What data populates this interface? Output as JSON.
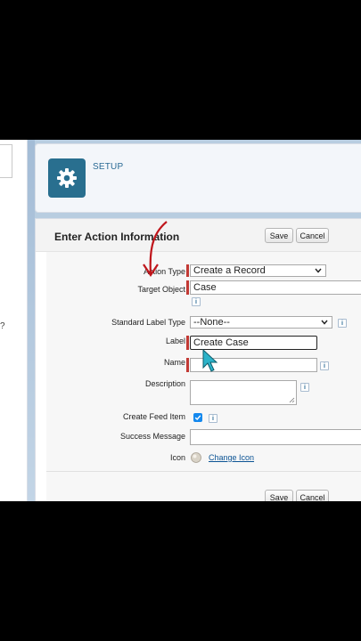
{
  "header": {
    "title": "SETUP",
    "icon": "gear-icon"
  },
  "form": {
    "title": "Enter Action Information",
    "buttons": {
      "save": "Save",
      "cancel": "Cancel"
    },
    "fields": {
      "action_type": {
        "label": "Action Type",
        "value": "Create a Record"
      },
      "target_object": {
        "label": "Target Object",
        "value": "Case"
      },
      "standard_label_type": {
        "label": "Standard Label Type",
        "value": "--None--"
      },
      "label": {
        "label": "Label",
        "value": "Create Case"
      },
      "name": {
        "label": "Name",
        "value": ""
      },
      "description": {
        "label": "Description",
        "value": ""
      },
      "create_feed_item": {
        "label": "Create Feed Item",
        "checked": true
      },
      "success_message": {
        "label": "Success Message",
        "value": ""
      },
      "icon": {
        "label": "Icon",
        "link": "Change Icon"
      }
    },
    "info_icon_text": "i"
  },
  "left_panel": {
    "glyph": "?"
  },
  "colors": {
    "required": "#c23934",
    "setup_tile": "#296f8f",
    "link": "#0b5394",
    "checkbox": "#1589ee",
    "annotation_arrow": "#c0161c",
    "cursor": "#2bb3c9"
  }
}
